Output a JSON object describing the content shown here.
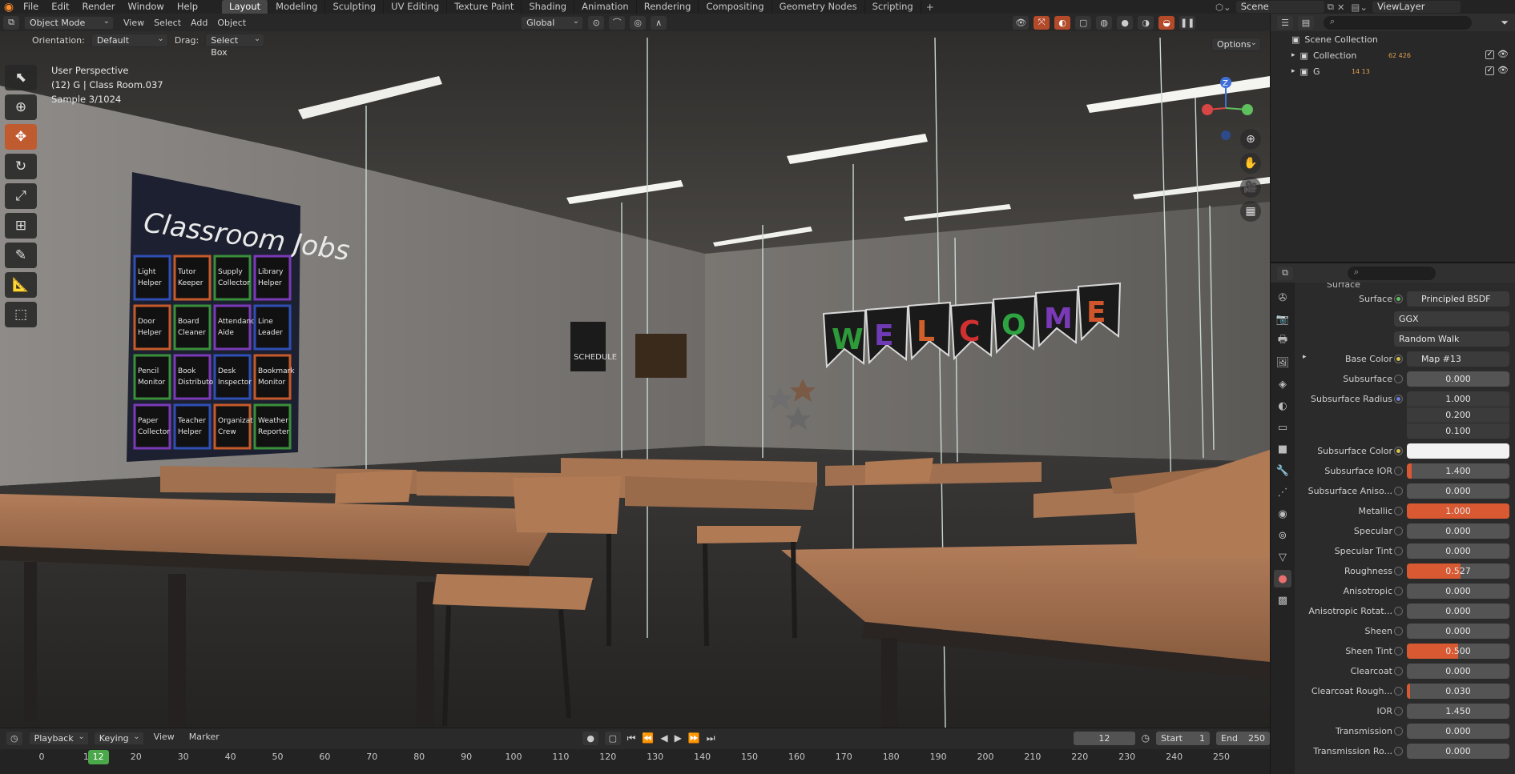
{
  "top_menu": [
    "File",
    "Edit",
    "Render",
    "Window",
    "Help"
  ],
  "workspace_tabs": [
    "Layout",
    "Modeling",
    "Sculpting",
    "UV Editing",
    "Texture Paint",
    "Shading",
    "Animation",
    "Rendering",
    "Compositing",
    "Geometry Nodes",
    "Scripting"
  ],
  "active_tab": "Layout",
  "scene": {
    "name": "Scene",
    "view_layer": "ViewLayer"
  },
  "viewport": {
    "mode": "Object Mode",
    "menus": [
      "View",
      "Select",
      "Add",
      "Object"
    ],
    "transform_orientation": "Global",
    "orientation_label": "Orientation:",
    "orientation_value": "Default",
    "drag_label": "Drag:",
    "drag_value": "Select Box",
    "options": "Options",
    "info_line1": "User Perspective",
    "info_line2": "(12) G | Class Room.037",
    "info_line3": "Sample 3/1024",
    "poster_title": "Classroom Jobs",
    "poster_jobs": [
      "Light Helper",
      "Tutor Keeper",
      "Supply Collector",
      "Library Helper",
      "Door Helper",
      "Board Cleaner",
      "Attendance Aide",
      "Line Leader",
      "Pencil Monitor",
      "Book Distributor",
      "Desk Inspector",
      "Bookmark Monitor",
      "Paper Collector",
      "Teacher Helper",
      "Organization Crew",
      "Weather Reporter"
    ],
    "banner_letters": [
      "W",
      "E",
      "L",
      "C",
      "O",
      "M",
      "E"
    ],
    "banner_colors": [
      "#2e9b3a",
      "#6f3bb5",
      "#d0602a",
      "#d13030",
      "#2ea342",
      "#7a3ab8",
      "#d0552a"
    ],
    "schedule_sign": "SCHEDULE"
  },
  "outliner": {
    "root": "Scene Collection",
    "rows": [
      {
        "name": "Collection",
        "counts": "62  426"
      },
      {
        "name": "G",
        "counts": "14  13"
      }
    ]
  },
  "properties": {
    "section": "Surface",
    "rows": [
      {
        "label": "Surface",
        "value": "Principled BSDF",
        "kind": "link",
        "dot": "green"
      },
      {
        "label": "",
        "value": "GGX",
        "kind": "menu"
      },
      {
        "label": "",
        "value": "Random Walk",
        "kind": "menu"
      },
      {
        "label": "Base Color",
        "value": "Map #13",
        "kind": "link",
        "dot": "yellow",
        "expand": true
      },
      {
        "label": "Subsurface",
        "value": "0.000",
        "kind": "num",
        "dot": "grey"
      },
      {
        "label": "Subsurface Radius",
        "value": [
          "1.000",
          "0.200",
          "0.100"
        ],
        "kind": "vec",
        "dot": "blue"
      },
      {
        "label": "Subsurface Color",
        "value": "",
        "kind": "color",
        "dot": "yellow"
      },
      {
        "label": "Subsurface IOR",
        "value": "1.400",
        "kind": "num",
        "dot": "grey",
        "fill": 0.05
      },
      {
        "label": "Subsurface Aniso...",
        "value": "0.000",
        "kind": "num",
        "dot": "grey"
      },
      {
        "label": "Metallic",
        "value": "1.000",
        "kind": "num",
        "dot": "grey",
        "fill": 1.0
      },
      {
        "label": "Specular",
        "value": "0.000",
        "kind": "num",
        "dot": "grey"
      },
      {
        "label": "Specular Tint",
        "value": "0.000",
        "kind": "num",
        "dot": "grey"
      },
      {
        "label": "Roughness",
        "value": "0.527",
        "kind": "num",
        "dot": "grey",
        "fill": 0.527
      },
      {
        "label": "Anisotropic",
        "value": "0.000",
        "kind": "num",
        "dot": "grey"
      },
      {
        "label": "Anisotropic Rotat...",
        "value": "0.000",
        "kind": "num",
        "dot": "grey"
      },
      {
        "label": "Sheen",
        "value": "0.000",
        "kind": "num",
        "dot": "grey"
      },
      {
        "label": "Sheen Tint",
        "value": "0.500",
        "kind": "num",
        "dot": "grey",
        "fill": 0.5
      },
      {
        "label": "Clearcoat",
        "value": "0.000",
        "kind": "num",
        "dot": "grey"
      },
      {
        "label": "Clearcoat Rough...",
        "value": "0.030",
        "kind": "num",
        "dot": "grey",
        "fill": 0.03
      },
      {
        "label": "IOR",
        "value": "1.450",
        "kind": "num",
        "dot": "grey"
      },
      {
        "label": "Transmission",
        "value": "0.000",
        "kind": "num",
        "dot": "grey"
      },
      {
        "label": "Transmission Ro...",
        "value": "0.000",
        "kind": "num",
        "dot": "grey"
      }
    ]
  },
  "timeline": {
    "menus": [
      "Playback",
      "Keying",
      "View",
      "Marker"
    ],
    "current_frame": "12",
    "start_label": "Start",
    "start": "1",
    "end_label": "End",
    "end": "250",
    "ticks": [
      "0",
      "10",
      "20",
      "30",
      "40",
      "50",
      "60",
      "70",
      "80",
      "90",
      "100",
      "110",
      "120",
      "130",
      "140",
      "150",
      "160",
      "170",
      "180",
      "190",
      "200",
      "210",
      "220",
      "230",
      "240",
      "250"
    ]
  },
  "colors": {
    "accent": "#d95a32",
    "frame": "#4aa84a"
  }
}
